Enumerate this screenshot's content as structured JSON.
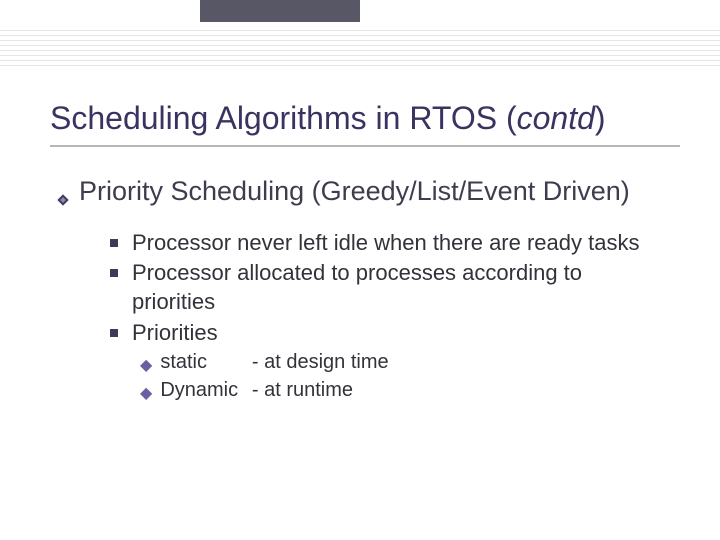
{
  "title": {
    "main": "Scheduling Algorithms in RTOS (",
    "ital": "contd",
    "close": ")"
  },
  "level1": {
    "text": "Priority Scheduling (Greedy/List/Event Driven)"
  },
  "level2": [
    {
      "text": "Processor never left idle when there are ready tasks"
    },
    {
      "text": "Processor allocated to processes according to priorities"
    },
    {
      "text": "Priorities"
    }
  ],
  "level3": [
    {
      "label": "static",
      "desc": "- at design time"
    },
    {
      "label": "Dynamic",
      "desc": "- at runtime"
    }
  ]
}
